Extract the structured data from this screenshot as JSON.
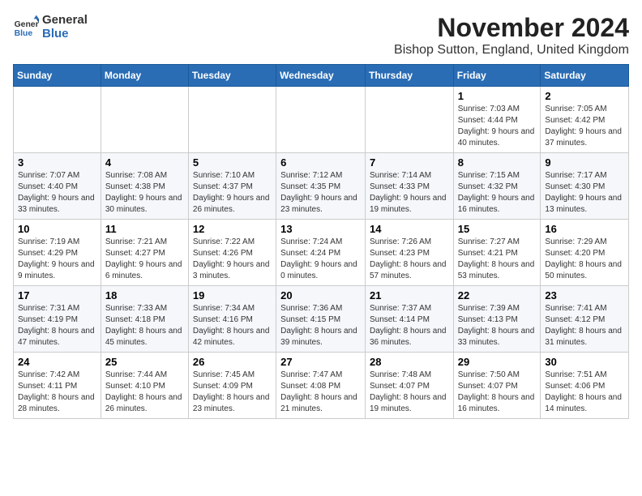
{
  "logo": {
    "general": "General",
    "blue": "Blue"
  },
  "title": "November 2024",
  "location": "Bishop Sutton, England, United Kingdom",
  "days_of_week": [
    "Sunday",
    "Monday",
    "Tuesday",
    "Wednesday",
    "Thursday",
    "Friday",
    "Saturday"
  ],
  "weeks": [
    [
      {
        "day": "",
        "info": ""
      },
      {
        "day": "",
        "info": ""
      },
      {
        "day": "",
        "info": ""
      },
      {
        "day": "",
        "info": ""
      },
      {
        "day": "",
        "info": ""
      },
      {
        "day": "1",
        "info": "Sunrise: 7:03 AM\nSunset: 4:44 PM\nDaylight: 9 hours and 40 minutes."
      },
      {
        "day": "2",
        "info": "Sunrise: 7:05 AM\nSunset: 4:42 PM\nDaylight: 9 hours and 37 minutes."
      }
    ],
    [
      {
        "day": "3",
        "info": "Sunrise: 7:07 AM\nSunset: 4:40 PM\nDaylight: 9 hours and 33 minutes."
      },
      {
        "day": "4",
        "info": "Sunrise: 7:08 AM\nSunset: 4:38 PM\nDaylight: 9 hours and 30 minutes."
      },
      {
        "day": "5",
        "info": "Sunrise: 7:10 AM\nSunset: 4:37 PM\nDaylight: 9 hours and 26 minutes."
      },
      {
        "day": "6",
        "info": "Sunrise: 7:12 AM\nSunset: 4:35 PM\nDaylight: 9 hours and 23 minutes."
      },
      {
        "day": "7",
        "info": "Sunrise: 7:14 AM\nSunset: 4:33 PM\nDaylight: 9 hours and 19 minutes."
      },
      {
        "day": "8",
        "info": "Sunrise: 7:15 AM\nSunset: 4:32 PM\nDaylight: 9 hours and 16 minutes."
      },
      {
        "day": "9",
        "info": "Sunrise: 7:17 AM\nSunset: 4:30 PM\nDaylight: 9 hours and 13 minutes."
      }
    ],
    [
      {
        "day": "10",
        "info": "Sunrise: 7:19 AM\nSunset: 4:29 PM\nDaylight: 9 hours and 9 minutes."
      },
      {
        "day": "11",
        "info": "Sunrise: 7:21 AM\nSunset: 4:27 PM\nDaylight: 9 hours and 6 minutes."
      },
      {
        "day": "12",
        "info": "Sunrise: 7:22 AM\nSunset: 4:26 PM\nDaylight: 9 hours and 3 minutes."
      },
      {
        "day": "13",
        "info": "Sunrise: 7:24 AM\nSunset: 4:24 PM\nDaylight: 9 hours and 0 minutes."
      },
      {
        "day": "14",
        "info": "Sunrise: 7:26 AM\nSunset: 4:23 PM\nDaylight: 8 hours and 57 minutes."
      },
      {
        "day": "15",
        "info": "Sunrise: 7:27 AM\nSunset: 4:21 PM\nDaylight: 8 hours and 53 minutes."
      },
      {
        "day": "16",
        "info": "Sunrise: 7:29 AM\nSunset: 4:20 PM\nDaylight: 8 hours and 50 minutes."
      }
    ],
    [
      {
        "day": "17",
        "info": "Sunrise: 7:31 AM\nSunset: 4:19 PM\nDaylight: 8 hours and 47 minutes."
      },
      {
        "day": "18",
        "info": "Sunrise: 7:33 AM\nSunset: 4:18 PM\nDaylight: 8 hours and 45 minutes."
      },
      {
        "day": "19",
        "info": "Sunrise: 7:34 AM\nSunset: 4:16 PM\nDaylight: 8 hours and 42 minutes."
      },
      {
        "day": "20",
        "info": "Sunrise: 7:36 AM\nSunset: 4:15 PM\nDaylight: 8 hours and 39 minutes."
      },
      {
        "day": "21",
        "info": "Sunrise: 7:37 AM\nSunset: 4:14 PM\nDaylight: 8 hours and 36 minutes."
      },
      {
        "day": "22",
        "info": "Sunrise: 7:39 AM\nSunset: 4:13 PM\nDaylight: 8 hours and 33 minutes."
      },
      {
        "day": "23",
        "info": "Sunrise: 7:41 AM\nSunset: 4:12 PM\nDaylight: 8 hours and 31 minutes."
      }
    ],
    [
      {
        "day": "24",
        "info": "Sunrise: 7:42 AM\nSunset: 4:11 PM\nDaylight: 8 hours and 28 minutes."
      },
      {
        "day": "25",
        "info": "Sunrise: 7:44 AM\nSunset: 4:10 PM\nDaylight: 8 hours and 26 minutes."
      },
      {
        "day": "26",
        "info": "Sunrise: 7:45 AM\nSunset: 4:09 PM\nDaylight: 8 hours and 23 minutes."
      },
      {
        "day": "27",
        "info": "Sunrise: 7:47 AM\nSunset: 4:08 PM\nDaylight: 8 hours and 21 minutes."
      },
      {
        "day": "28",
        "info": "Sunrise: 7:48 AM\nSunset: 4:07 PM\nDaylight: 8 hours and 19 minutes."
      },
      {
        "day": "29",
        "info": "Sunrise: 7:50 AM\nSunset: 4:07 PM\nDaylight: 8 hours and 16 minutes."
      },
      {
        "day": "30",
        "info": "Sunrise: 7:51 AM\nSunset: 4:06 PM\nDaylight: 8 hours and 14 minutes."
      }
    ]
  ]
}
